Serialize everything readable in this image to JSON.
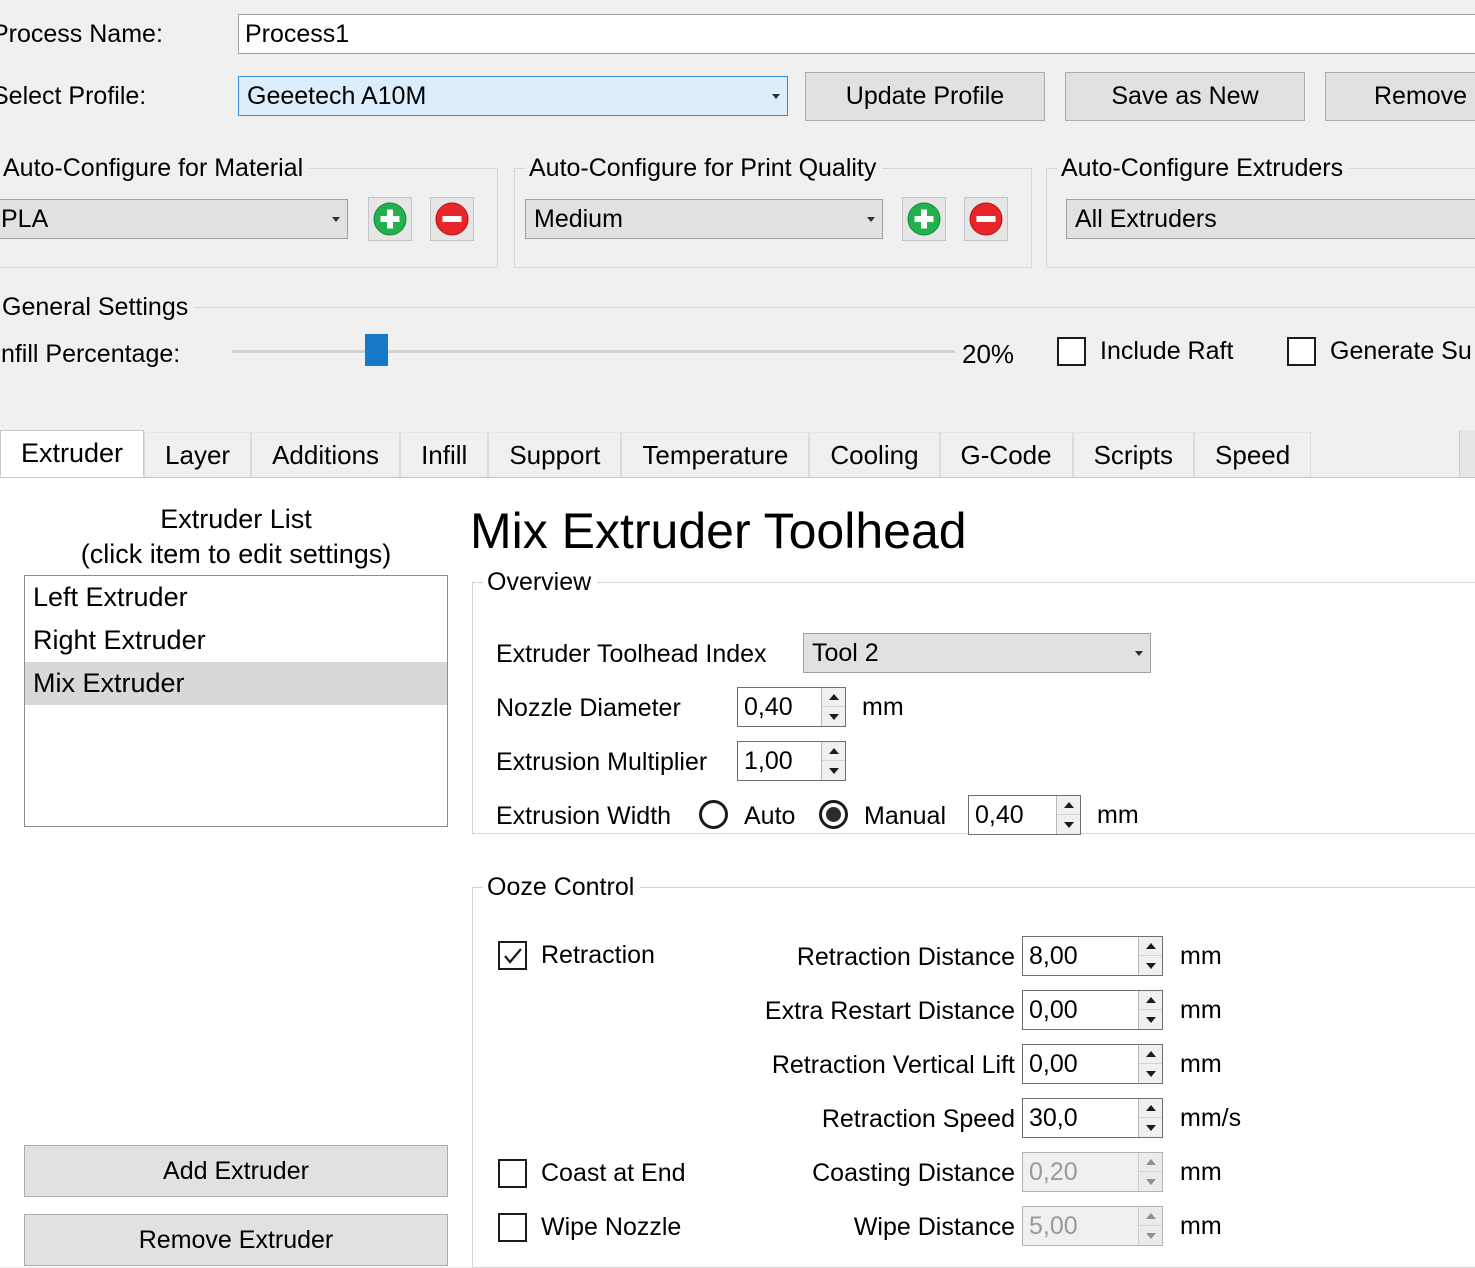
{
  "window": {
    "process_name_label": "Process Name:",
    "process_name_value": "Process1",
    "select_profile_label": "Select Profile:",
    "select_profile_value": "Geeetech A10M",
    "buttons": {
      "update_profile": "Update Profile",
      "save_as_new": "Save as New",
      "remove": "Remove"
    }
  },
  "auto_material": {
    "title": "Auto-Configure for Material",
    "value": "PLA",
    "add_icon": "plus-circle-icon",
    "remove_icon": "minus-circle-icon",
    "add_color": "#22b14c",
    "remove_color": "#e8262a"
  },
  "auto_quality": {
    "title": "Auto-Configure for Print Quality",
    "value": "Medium",
    "add_icon": "plus-circle-icon",
    "remove_icon": "minus-circle-icon"
  },
  "auto_extruders": {
    "title": "Auto-Configure Extruders",
    "value": "All Extruders"
  },
  "general": {
    "title": "General Settings",
    "infill_label": "Infill Percentage:",
    "infill_value": "20%",
    "infill_percent": 20,
    "slider_color": "#1479c8",
    "include_raft_label": "Include Raft",
    "include_raft_checked": false,
    "generate_support_label": "Generate Su",
    "generate_support_checked": false
  },
  "tabs": [
    {
      "label": "Extruder",
      "active": true
    },
    {
      "label": "Layer",
      "active": false
    },
    {
      "label": "Additions",
      "active": false
    },
    {
      "label": "Infill",
      "active": false
    },
    {
      "label": "Support",
      "active": false
    },
    {
      "label": "Temperature",
      "active": false
    },
    {
      "label": "Cooling",
      "active": false
    },
    {
      "label": "G-Code",
      "active": false
    },
    {
      "label": "Scripts",
      "active": false
    },
    {
      "label": "Speed",
      "active": false
    }
  ],
  "extruder_panel": {
    "list_title_line1": "Extruder List",
    "list_title_line2": "(click item to edit settings)",
    "items": [
      {
        "label": "Left Extruder",
        "selected": false
      },
      {
        "label": "Right Extruder",
        "selected": false
      },
      {
        "label": "Mix Extruder",
        "selected": true
      }
    ],
    "add_button": "Add Extruder",
    "remove_button": "Remove Extruder"
  },
  "toolhead": {
    "heading": "Mix Extruder Toolhead",
    "overview": {
      "title": "Overview",
      "index_label": "Extruder Toolhead Index",
      "index_value": "Tool 2",
      "nozzle_label": "Nozzle Diameter",
      "nozzle_value": "0,40",
      "nozzle_unit": "mm",
      "multiplier_label": "Extrusion Multiplier",
      "multiplier_value": "1,00",
      "width_label": "Extrusion Width",
      "width_auto_label": "Auto",
      "width_auto_selected": false,
      "width_manual_label": "Manual",
      "width_manual_selected": true,
      "width_value": "0,40",
      "width_unit": "mm"
    },
    "ooze": {
      "title": "Ooze Control",
      "retraction_label": "Retraction",
      "retraction_checked": true,
      "coast_label": "Coast at End",
      "coast_checked": false,
      "wipe_label": "Wipe Nozzle",
      "wipe_checked": false,
      "rows": [
        {
          "label": "Retraction Distance",
          "value": "8,00",
          "unit": "mm",
          "disabled": false
        },
        {
          "label": "Extra Restart Distance",
          "value": "0,00",
          "unit": "mm",
          "disabled": false
        },
        {
          "label": "Retraction Vertical Lift",
          "value": "0,00",
          "unit": "mm",
          "disabled": false
        },
        {
          "label": "Retraction Speed",
          "value": "30,0",
          "unit": "mm/s",
          "disabled": false
        },
        {
          "label": "Coasting Distance",
          "value": "0,20",
          "unit": "mm",
          "disabled": true
        },
        {
          "label": "Wipe Distance",
          "value": "5,00",
          "unit": "mm",
          "disabled": true
        }
      ]
    }
  }
}
